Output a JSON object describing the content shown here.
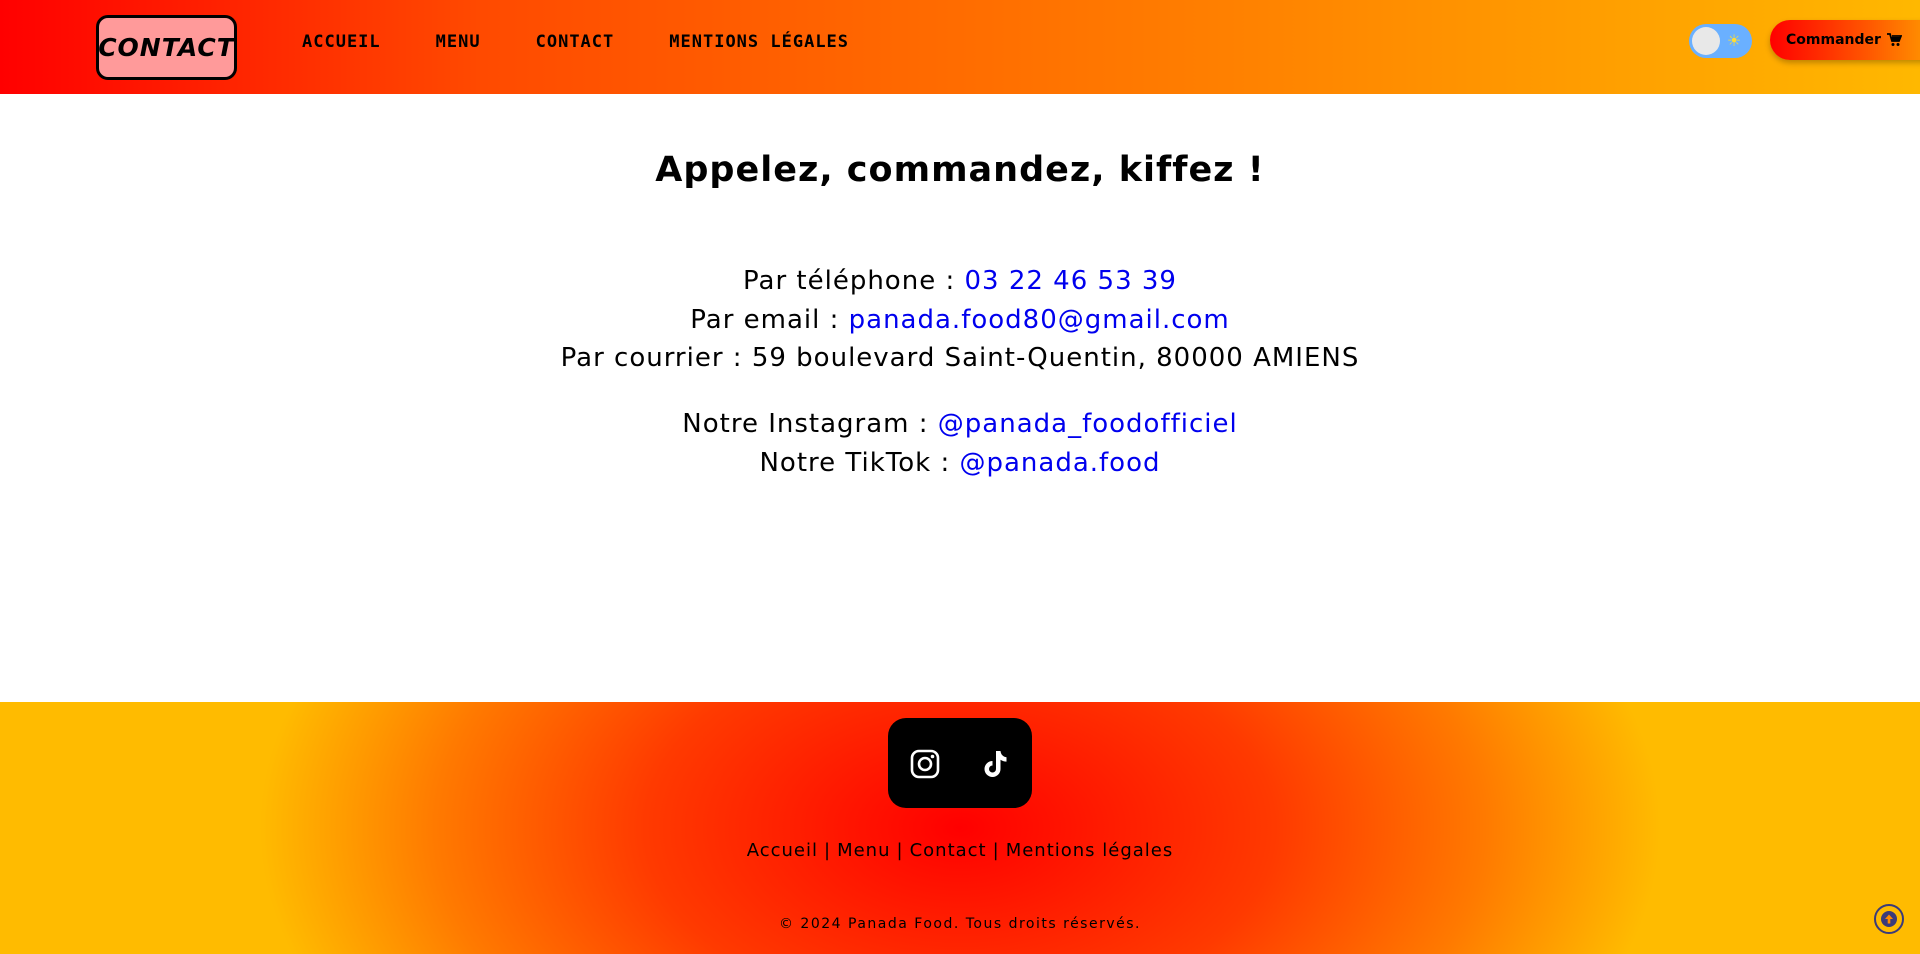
{
  "header": {
    "logo_text": "CONTACT",
    "nav": [
      {
        "label": "ACCUEIL"
      },
      {
        "label": "MENU"
      },
      {
        "label": "CONTACT"
      },
      {
        "label": "MENTIONS LÉGALES"
      }
    ],
    "order_button_label": "Commander",
    "theme_toggle_state": "light"
  },
  "main": {
    "title": "Appelez, commandez, kiffez !",
    "phone_label": "Par téléphone : ",
    "phone_value": "03 22 46 53 39",
    "email_label": "Par email : ",
    "email_value": "panada.food80@gmail.com",
    "mail_label": "Par courrier : ",
    "mail_value": "59 boulevard Saint-Quentin, 80000 AMIENS",
    "instagram_label": "Notre Instagram : ",
    "instagram_value": "@panada_foodofficiel",
    "tiktok_label": "Notre TikTok : ",
    "tiktok_value": "@panada.food"
  },
  "footer": {
    "social_icons": [
      "instagram-icon",
      "tiktok-icon"
    ],
    "links": [
      {
        "label": "Accueil"
      },
      {
        "label": "Menu"
      },
      {
        "label": "Contact"
      },
      {
        "label": "Mentions légales"
      }
    ],
    "separator": "|",
    "copyright": "© 2024 Panada Food. Tous droits réservés."
  },
  "colors": {
    "link": "#0000ee",
    "header_start": "#ff0000",
    "header_end": "#ffb800",
    "logo_bg": "#ff9a9a"
  }
}
